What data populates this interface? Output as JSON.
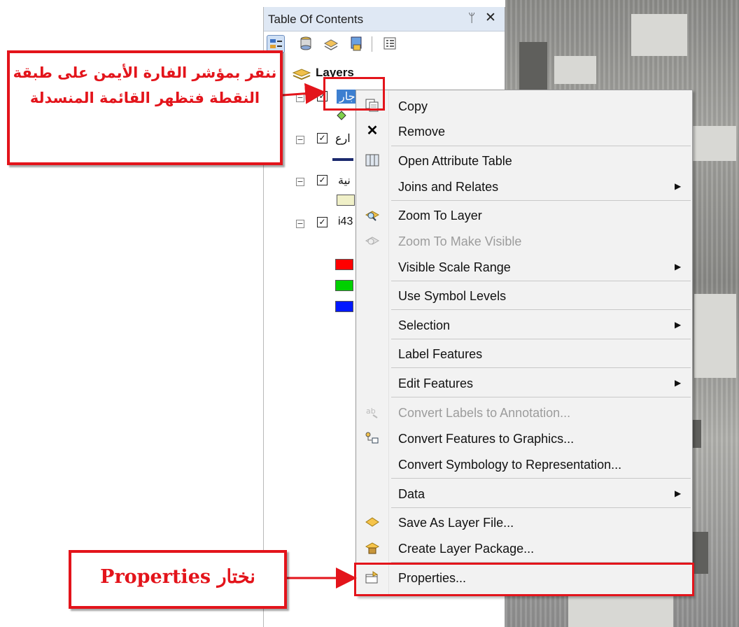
{
  "toc": {
    "title": "Table Of Contents",
    "pin_glyph": "ᛘ",
    "close_glyph": "✕",
    "root_label": "Layers",
    "layers": [
      {
        "name": "جار",
        "checked": true
      },
      {
        "name": "ارع",
        "checked": true
      },
      {
        "name": "نية",
        "checked": true
      },
      {
        "name": "i43",
        "checked": true
      }
    ],
    "raster_colors": [
      "#ff0000",
      "#00d000",
      "#0018ff"
    ]
  },
  "menu": {
    "items": [
      {
        "label": "Copy",
        "icon": "copy-icon",
        "enabled": true,
        "submenu": false
      },
      {
        "label": "Remove",
        "icon": "remove-x-icon",
        "enabled": true,
        "submenu": false
      },
      {
        "label": "Open Attribute Table",
        "icon": "table-icon",
        "enabled": true,
        "submenu": false
      },
      {
        "label": "Joins and Relates",
        "icon": "",
        "enabled": true,
        "submenu": true
      },
      {
        "label": "Zoom To Layer",
        "icon": "zoom-layer-icon",
        "enabled": true,
        "submenu": false
      },
      {
        "label": "Zoom To Make Visible",
        "icon": "zoom-visible-icon",
        "enabled": false,
        "submenu": false
      },
      {
        "label": "Visible Scale Range",
        "icon": "",
        "enabled": true,
        "submenu": true
      },
      {
        "label": "Use Symbol Levels",
        "icon": "",
        "enabled": true,
        "submenu": false
      },
      {
        "label": "Selection",
        "icon": "",
        "enabled": true,
        "submenu": true
      },
      {
        "label": "Label Features",
        "icon": "",
        "enabled": true,
        "submenu": false
      },
      {
        "label": "Edit Features",
        "icon": "",
        "enabled": true,
        "submenu": true
      },
      {
        "label": "Convert Labels to Annotation...",
        "icon": "convert-labels-icon",
        "enabled": false,
        "submenu": false
      },
      {
        "label": "Convert Features to Graphics...",
        "icon": "convert-graphics-icon",
        "enabled": true,
        "submenu": false
      },
      {
        "label": "Convert Symbology to Representation...",
        "icon": "",
        "enabled": true,
        "submenu": false
      },
      {
        "label": "Data",
        "icon": "",
        "enabled": true,
        "submenu": true
      },
      {
        "label": "Save As Layer File...",
        "icon": "layer-file-icon",
        "enabled": true,
        "submenu": false
      },
      {
        "label": "Create Layer Package...",
        "icon": "layer-package-icon",
        "enabled": true,
        "submenu": false
      },
      {
        "label": "Properties...",
        "icon": "properties-icon",
        "enabled": true,
        "submenu": false
      }
    ],
    "submenu_arrow": "▶"
  },
  "annotations": {
    "right_click_note": "ننقر بمؤشر الفارة الأيمن على طبقة النقطة فتظهر القائمة المنسدلة",
    "properties_note": "نختار Properties"
  },
  "colors": {
    "annotation_red": "#e3141b",
    "toc_header": "#dfe8f4"
  }
}
